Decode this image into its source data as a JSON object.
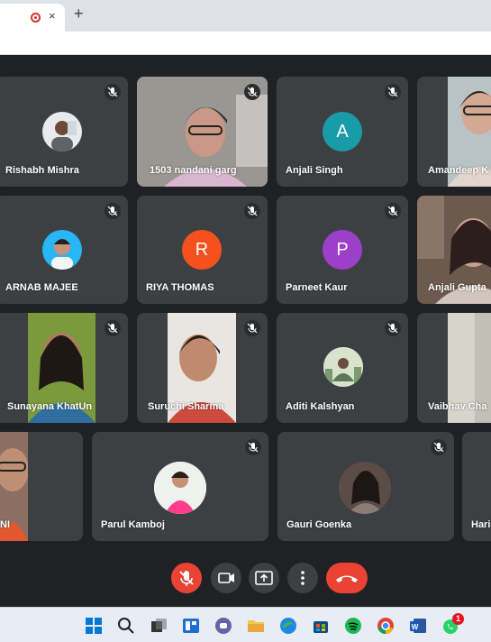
{
  "browser": {
    "tab_close_glyph": "×",
    "new_tab_glyph": "+"
  },
  "participants": {
    "rishabh": "Rishabh Mishra",
    "nandani": "1503 nandani garg",
    "anjali_singh": "Anjali Singh",
    "anjali_singh_initial": "A",
    "amandeep": "Amandeep K",
    "arnab": "ARNAB MAJEE",
    "riya": "RIYA THOMAS",
    "riya_initial": "R",
    "parneet": "Parneet Kaur",
    "parneet_initial": "P",
    "anjali_gupta": "Anjali Gupta",
    "sunayana": "Sunayana KhatUn",
    "suruchi": "Suruchi Sharma",
    "aditi": "Aditi Kalshyan",
    "vaibhav": "Vaibhav Cha",
    "ni": "NI",
    "parul": "Parul Kamboj",
    "gauri": "Gauri Goenka",
    "hari": "Hari"
  },
  "colors": {
    "meet_bg": "#202124",
    "tile_bg": "#3c4043",
    "avatar_teal": "#1a9ba8",
    "avatar_orange": "#f4511e",
    "avatar_purple": "#9c3fc9",
    "end_call_red": "#ea4335"
  },
  "taskbar": {
    "whatsapp_badge": "1"
  }
}
